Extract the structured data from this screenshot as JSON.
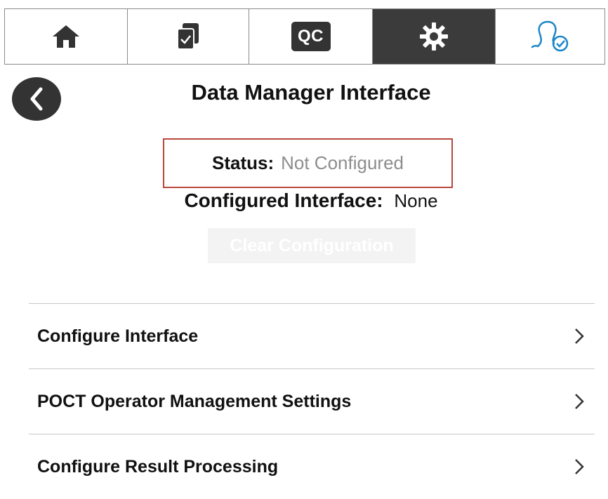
{
  "nav": {
    "tabs": [
      {
        "name": "home",
        "icon": "home-icon"
      },
      {
        "name": "checklist",
        "icon": "checklist-icon"
      },
      {
        "name": "qc",
        "label": "QC",
        "icon": "qc-icon"
      },
      {
        "name": "settings",
        "icon": "gear-icon",
        "active": true
      },
      {
        "name": "operator",
        "icon": "user-check-icon"
      }
    ],
    "active_color": "#3b3b3b",
    "accent_color": "#1a86c8"
  },
  "page": {
    "title": "Data Manager Interface",
    "status_label": "Status:",
    "status_value": "Not Configured",
    "configured_label": "Configured Interface:",
    "configured_value": "None",
    "clear_button": "Clear Configuration"
  },
  "menu": {
    "items": [
      {
        "label": "Configure Interface"
      },
      {
        "label": "POCT Operator Management Settings"
      },
      {
        "label": "Configure Result Processing"
      }
    ]
  },
  "colors": {
    "highlight_border": "#b8473c",
    "status_value": "#8d8d8d"
  }
}
